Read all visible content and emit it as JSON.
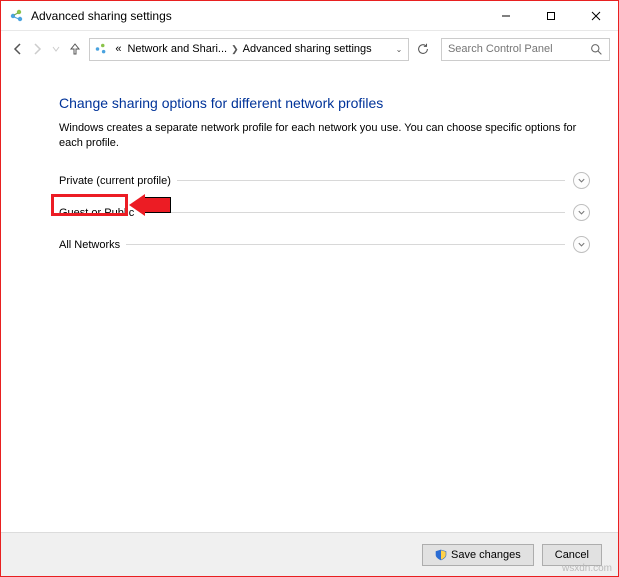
{
  "window": {
    "title": "Advanced sharing settings"
  },
  "breadcrumb": {
    "prefix": "«",
    "item1": "Network and Shari...",
    "item2": "Advanced sharing settings"
  },
  "search": {
    "placeholder": "Search Control Panel"
  },
  "page": {
    "heading": "Change sharing options for different network profiles",
    "description": "Windows creates a separate network profile for each network you use. You can choose specific options for each profile."
  },
  "sections": [
    {
      "label": "Private (current profile)"
    },
    {
      "label": "Guest or Public"
    },
    {
      "label": "All Networks"
    }
  ],
  "footer": {
    "save": "Save changes",
    "cancel": "Cancel"
  },
  "watermark": "wsxdn.com"
}
